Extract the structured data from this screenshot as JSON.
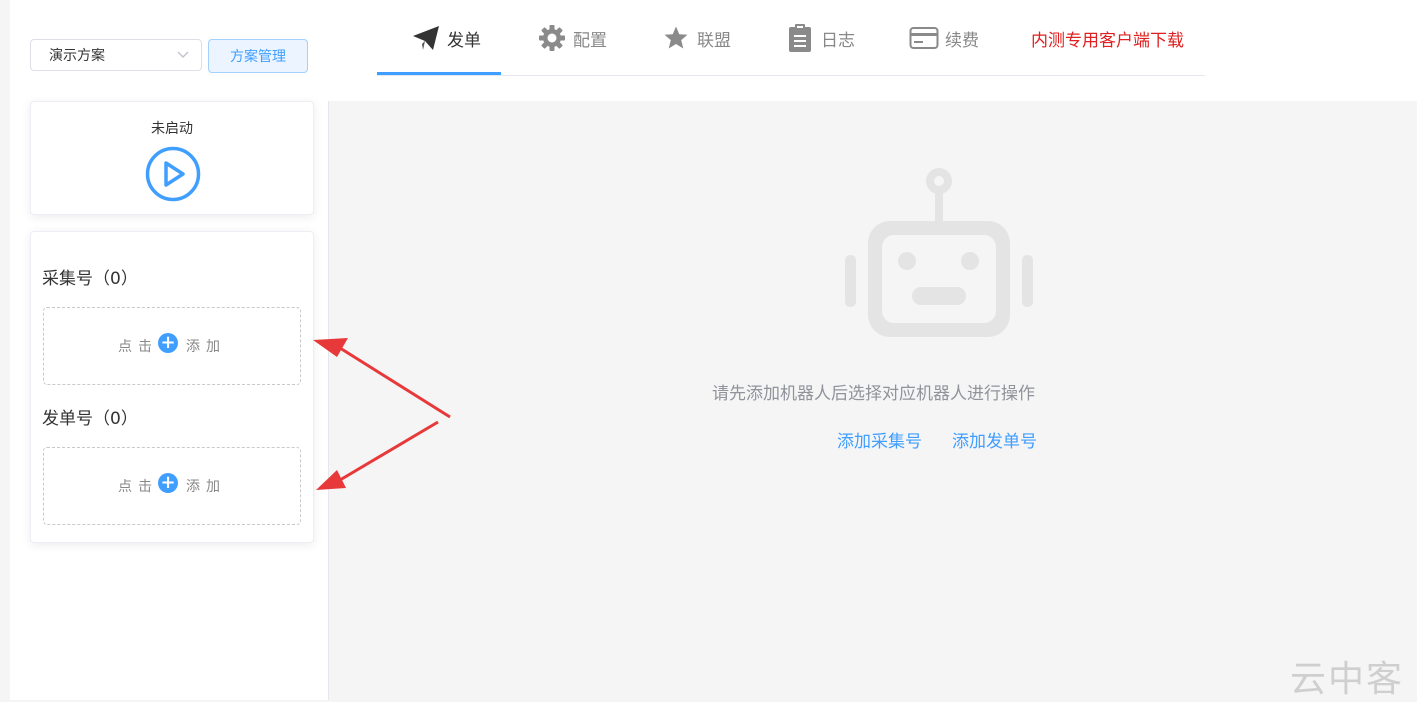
{
  "scheme": {
    "selected": "演示方案",
    "manage_label": "方案管理"
  },
  "tabs": [
    {
      "label": "发单",
      "icon": "paper-plane-icon",
      "active": true
    },
    {
      "label": "配置",
      "icon": "gear-icon"
    },
    {
      "label": "联盟",
      "icon": "star-icon"
    },
    {
      "label": "日志",
      "icon": "clipboard-icon"
    },
    {
      "label": "续费",
      "icon": "credit-card-icon"
    },
    {
      "label": "内测专用客户端下载",
      "color": "#e02020"
    }
  ],
  "status": {
    "text": "未启动",
    "icon": "play-icon"
  },
  "collect": {
    "title": "采集号（0）",
    "add_prefix": "点击",
    "add_suffix": "添加"
  },
  "send": {
    "title": "发单号（0）",
    "add_prefix": "点击",
    "add_suffix": "添加"
  },
  "empty": {
    "icon": "robot-icon",
    "hint": "请先添加机器人后选择对应机器人进行操作",
    "link_collect": "添加采集号",
    "link_send": "添加发单号"
  },
  "watermark": "云中客",
  "colors": {
    "accent": "#409eff",
    "download": "#e02020",
    "annotation_arrow": "#e8393a"
  }
}
